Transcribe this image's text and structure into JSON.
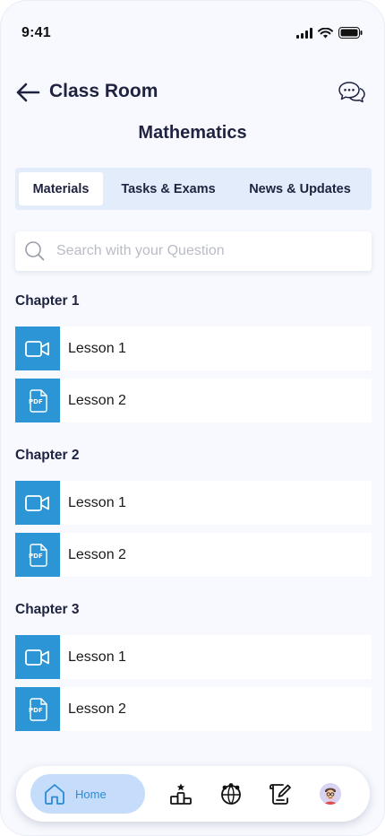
{
  "status_bar": {
    "time": "9:41"
  },
  "header": {
    "title": "Class Room"
  },
  "subject": "Mathematics",
  "tabs": [
    {
      "label": "Materials",
      "active": true
    },
    {
      "label": "Tasks & Exams",
      "active": false
    },
    {
      "label": "News & Updates",
      "active": false
    }
  ],
  "search": {
    "placeholder": "Search with your Question"
  },
  "chapters": [
    {
      "title": "Chapter 1",
      "lessons": [
        {
          "label": "Lesson 1",
          "type": "video-icon"
        },
        {
          "label": "Lesson 2",
          "type": "pdf-icon"
        }
      ]
    },
    {
      "title": "Chapter 2",
      "lessons": [
        {
          "label": "Lesson 1",
          "type": "video-icon"
        },
        {
          "label": "Lesson 2",
          "type": "pdf-icon"
        }
      ]
    },
    {
      "title": "Chapter 3",
      "lessons": [
        {
          "label": "Lesson 1",
          "type": "video-icon"
        },
        {
          "label": "Lesson 2",
          "type": "pdf-icon"
        }
      ]
    }
  ],
  "bottom_nav": {
    "home_label": "Home",
    "items": [
      "home-icon",
      "leaderboard-icon",
      "community-icon",
      "edit-document-icon",
      "profile-avatar"
    ]
  },
  "colors": {
    "accent": "#2b95d6",
    "tab_bg": "#e3ecfb",
    "home_pill": "#c5ddfb",
    "text_dark": "#1f2340"
  }
}
